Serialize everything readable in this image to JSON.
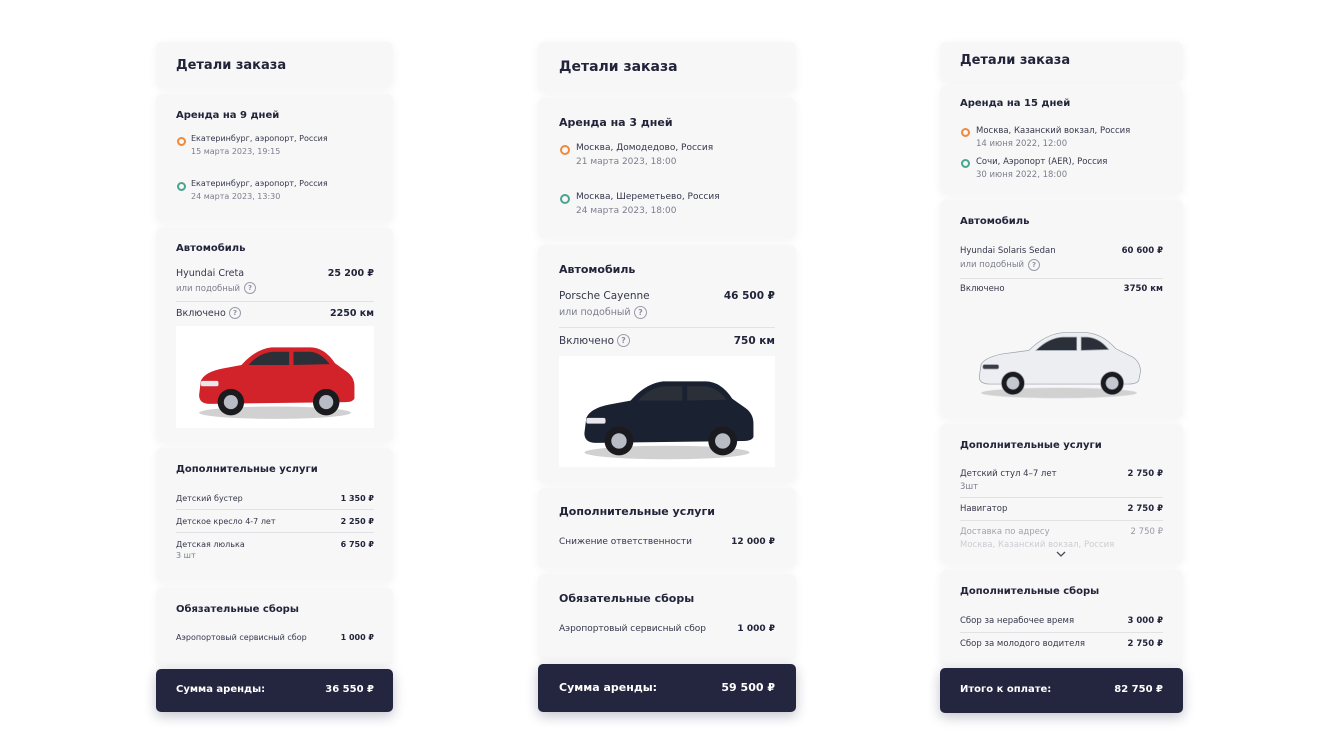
{
  "colors": {
    "dark": "#24253f",
    "card": "#f7f7f8",
    "orange": "#ef8a3a",
    "green": "#4aa58e"
  },
  "icons": {
    "from": "circle-orange-icon",
    "to": "circle-green-icon",
    "help": "question-circle-icon",
    "expand": "chevron-down-icon"
  },
  "variants": [
    {
      "title": "Детали заказа",
      "rental": "Аренда на 9 дней",
      "from": {
        "place": "Екатеринбург, аэропорт, Россия",
        "date": "15 марта 2023, 19:15"
      },
      "to": {
        "place": "Екатеринбург, аэропорт, Россия",
        "date": "24 марта 2023, 13:30"
      },
      "car_heading": "Автомобиль",
      "car_name": "Hyundai Creta",
      "car_alt": "или подобный",
      "car_price": "25 200 ₽",
      "included_label": "Включено",
      "included_value": "2250 км",
      "car_color": "red",
      "extras_heading": "Дополнительные услуги",
      "extras": [
        {
          "name": "Детский бустер",
          "price": "1 350 ₽"
        },
        {
          "name": "Детское кресло 4-7 лет",
          "price": "2 250 ₽"
        },
        {
          "name": "Детская люлька",
          "sub": "3 шт",
          "price": "6 750 ₽"
        }
      ],
      "fees_heading": "Обязательные сборы",
      "fees": [
        {
          "name": "Аэропортовый сервисный сбор",
          "price": "1 000 ₽"
        }
      ],
      "total_label": "Сумма аренды:",
      "total_value": "36 550 ₽"
    },
    {
      "title": "Детали заказа",
      "rental": "Аренда на 3 дней",
      "from": {
        "place": "Москва, Домодедово, Россия",
        "date": "21 марта 2023, 18:00"
      },
      "to": {
        "place": "Москва, Шереметьево, Россия",
        "date": "24 марта 2023, 18:00"
      },
      "car_heading": "Автомобиль",
      "car_name": "Porsche Cayenne",
      "car_alt": "или подобный",
      "car_price": "46 500 ₽",
      "included_label": "Включено",
      "included_value": "750 км",
      "car_color": "black",
      "extras_heading": "Дополнительные услуги",
      "extras": [
        {
          "name": "Снижение ответственности",
          "price": "12 000 ₽"
        }
      ],
      "fees_heading": "Обязательные сборы",
      "fees": [
        {
          "name": "Аэропортовый сервисный сбор",
          "price": "1 000 ₽"
        }
      ],
      "total_label": "Сумма аренды:",
      "total_value": "59 500 ₽"
    },
    {
      "title": "Детали заказа",
      "rental": "Аренда на 15 дней",
      "from": {
        "place": "Москва, Казанский вокзал, Россия",
        "date": "14 июня 2022, 12:00"
      },
      "to": {
        "place": "Сочи, Аэропорт (AER), Россия",
        "date": "30 июня 2022, 18:00"
      },
      "car_heading": "Автомобиль",
      "car_name": "Hyundai Solaris Sedan",
      "car_alt": "или подобный",
      "car_price": "60 600 ₽",
      "included_label": "Включено",
      "included_value": "3750 км",
      "car_color": "white",
      "extras_heading": "Дополнительные услуги",
      "extras": [
        {
          "name": "Детский стул 4–7 лет",
          "sub": "3шт",
          "price": "2 750 ₽"
        },
        {
          "name": "Навигатор",
          "price": "2 750 ₽"
        },
        {
          "name": "Доставка по адресу",
          "sub": "Москва, Казанский вокзал, Россия",
          "price": "2 750 ₽"
        }
      ],
      "fees_heading": "Дополнительные сборы",
      "fees": [
        {
          "name": "Сбор за нерабочее время",
          "price": "3 000 ₽"
        },
        {
          "name": "Сбор за молодого водителя",
          "price": "2 750 ₽"
        }
      ],
      "total_label": "Итого к оплате:",
      "total_value": "82 750 ₽"
    }
  ]
}
